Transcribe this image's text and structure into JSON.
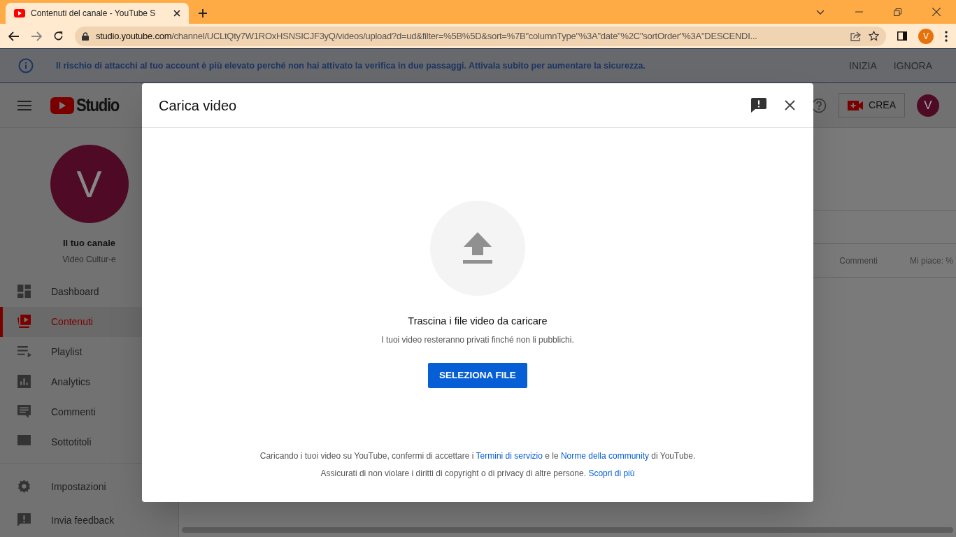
{
  "browser": {
    "tab": {
      "title": "Contenuti del canale - YouTube S"
    },
    "url_host": "studio.youtube.com",
    "url_path": "/channel/UCLtQty7W1ROxHSNSICJF3yQ/videos/upload?d=ud&filter=%5B%5D&sort=%7B\"columnType\"%3A\"date\"%2C\"sortOrder\"%3A\"DESCENDI...",
    "profile_initial": "V"
  },
  "security_banner": {
    "message": "Il rischio di attacchi al tuo account è più elevato perché non hai attivato la verifica in due passaggi. Attivala subito per aumentare la sicurezza.",
    "actions": [
      "INIZIA",
      "IGNORA"
    ]
  },
  "studio": {
    "logo_text": "Studio",
    "create_label": "CREA",
    "avatar_initial": "V",
    "channel": {
      "initial": "V",
      "title": "Il tuo canale",
      "name": "Video Cultur-e"
    },
    "nav": [
      {
        "label": "Dashboard",
        "selected": false
      },
      {
        "label": "Contenuti",
        "selected": true
      },
      {
        "label": "Playlist",
        "selected": false
      },
      {
        "label": "Analytics",
        "selected": false
      },
      {
        "label": "Commenti",
        "selected": false
      },
      {
        "label": "Sottotitoli",
        "selected": false
      }
    ],
    "bottom_nav": [
      {
        "label": "Impostazioni"
      },
      {
        "label": "Invia feedback"
      }
    ],
    "table_columns": [
      "Commenti",
      "Mi piace: %"
    ]
  },
  "dialog": {
    "title": "Carica video",
    "drop_title": "Trascina i file video da caricare",
    "drop_subtitle": "I tuoi video resteranno privati finché non li pubblichi.",
    "button": "SELEZIONA FILE",
    "legal": [
      [
        {
          "kind": "text",
          "text": "Caricando i tuoi video su YouTube, confermi di accettare i "
        },
        {
          "kind": "link",
          "text": "Termini di servizio"
        },
        {
          "kind": "text",
          "text": " e le "
        },
        {
          "kind": "link",
          "text": "Norme della community"
        },
        {
          "kind": "text",
          "text": " di YouTube."
        }
      ],
      [
        {
          "kind": "text",
          "text": "Assicurati di non violare i diritti di copyright o di privacy di altre persone. "
        },
        {
          "kind": "link",
          "text": "Scopri di più"
        }
      ]
    ]
  }
}
